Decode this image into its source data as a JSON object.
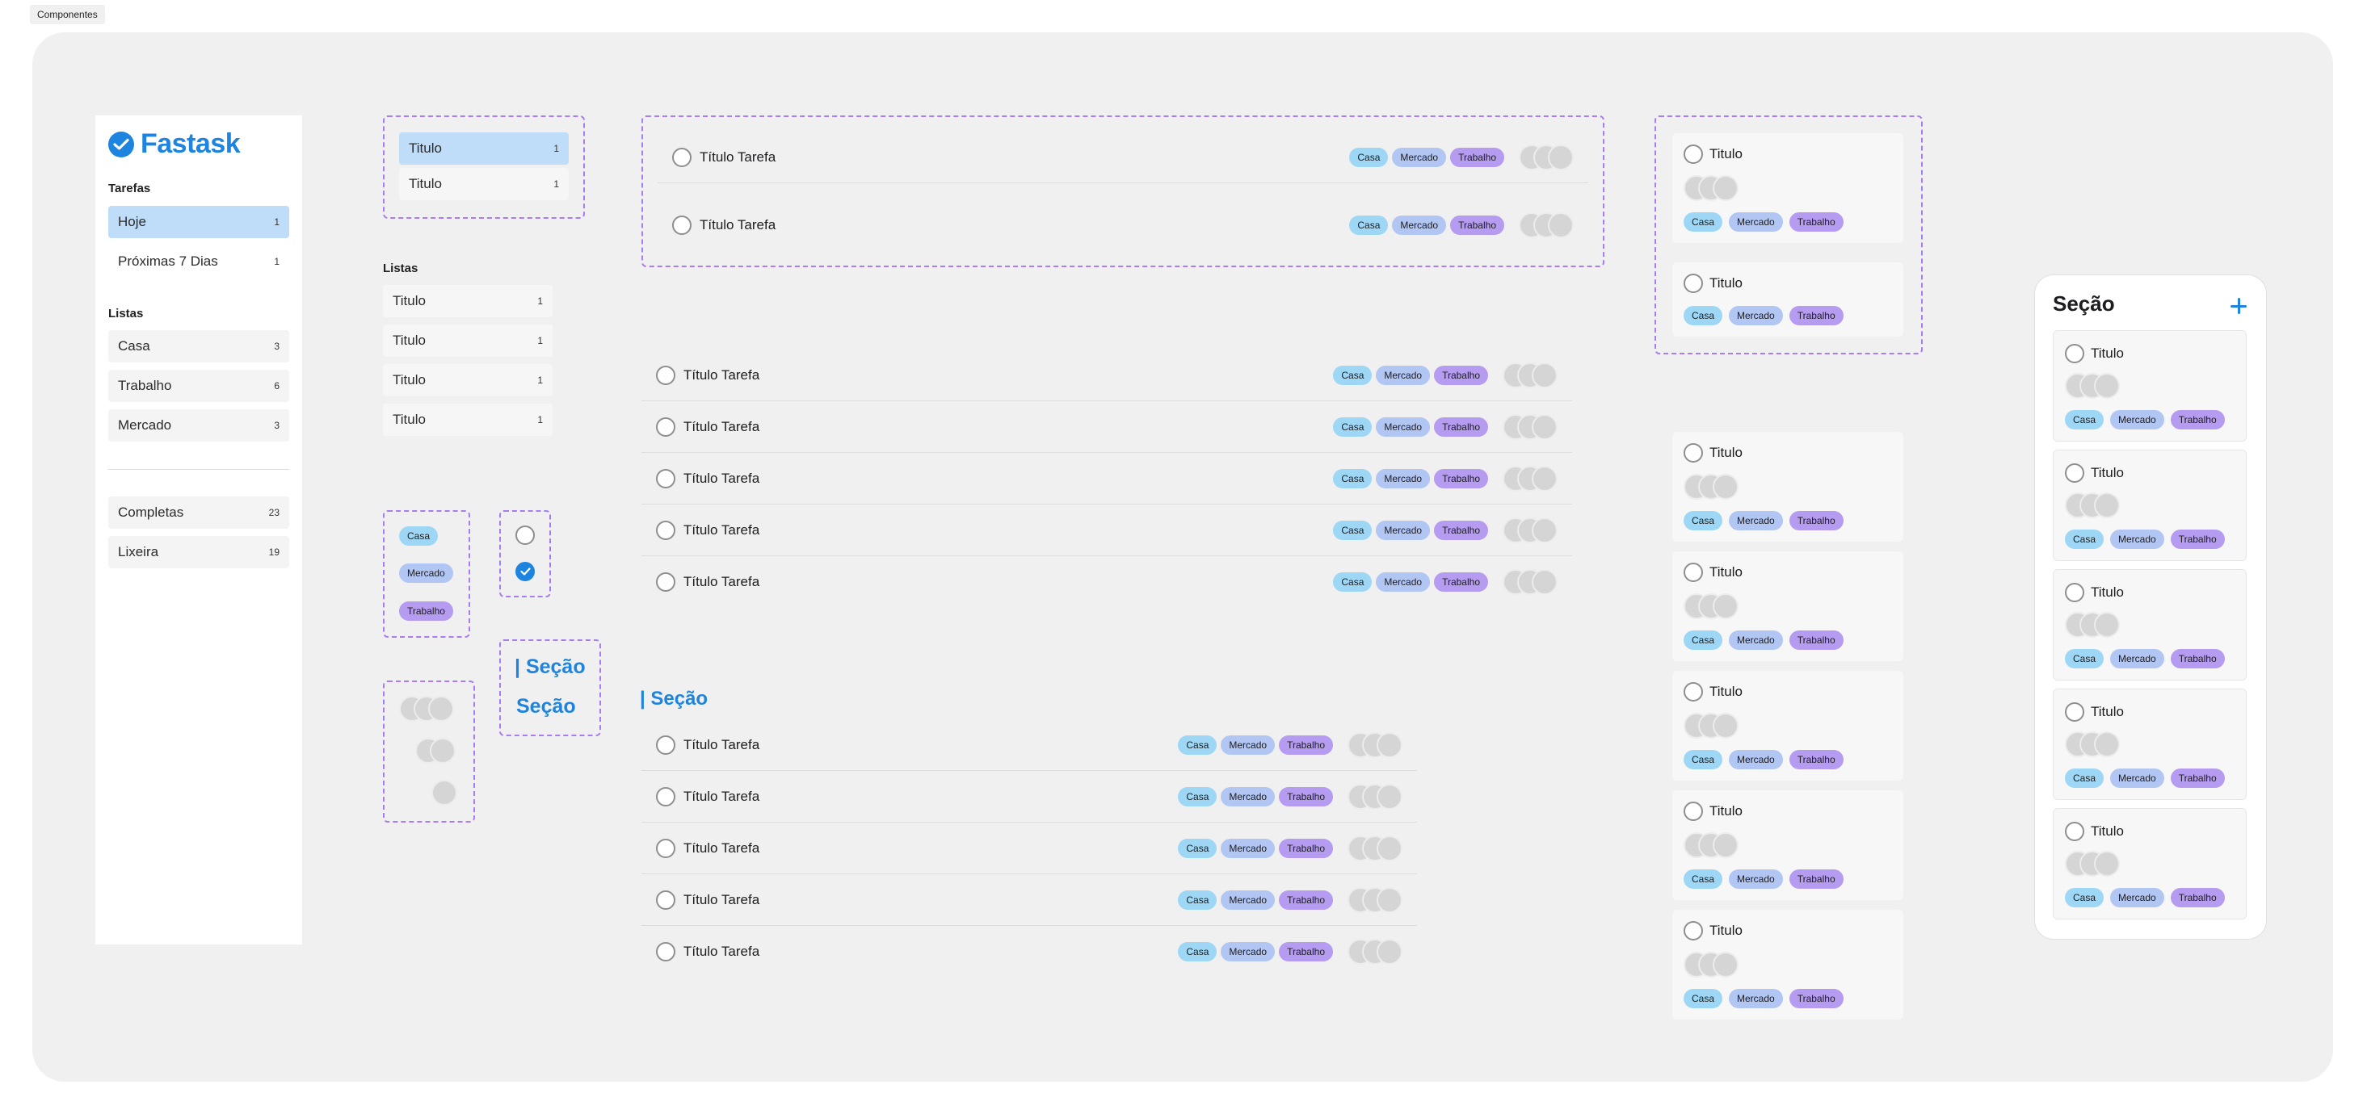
{
  "frame_label": "Componentes",
  "brand": {
    "name": "Fastask",
    "color": "#1d84e0"
  },
  "sidebar": {
    "tasks_heading": "Tarefas",
    "task_items": [
      {
        "label": "Hoje",
        "count": "1",
        "active": true
      },
      {
        "label": "Próximas 7 Dias",
        "count": "1"
      }
    ],
    "lists_heading": "Listas",
    "list_items": [
      {
        "label": "Casa",
        "count": "3"
      },
      {
        "label": "Trabalho",
        "count": "6"
      },
      {
        "label": "Mercado",
        "count": "3"
      }
    ],
    "extra_items": [
      {
        "label": "Completas",
        "count": "23"
      },
      {
        "label": "Lixeira",
        "count": "19"
      }
    ]
  },
  "components": {
    "nav_variants": [
      {
        "label": "Titulo",
        "count": "1"
      },
      {
        "label": "Titulo",
        "count": "1"
      }
    ],
    "lists_heading": "Listas",
    "list_variants": [
      {
        "label": "Titulo",
        "count": "1"
      },
      {
        "label": "Titulo",
        "count": "1"
      },
      {
        "label": "Titulo",
        "count": "1"
      },
      {
        "label": "Titulo",
        "count": "1"
      }
    ],
    "tags": [
      "Casa",
      "Mercado",
      "Trabalho"
    ],
    "section_variant_a": "| Seção",
    "section_variant_b": "Seção"
  },
  "tag_labels": {
    "casa": "Casa",
    "mercado": "Mercado",
    "trabalho": "Trabalho"
  },
  "task_title": "Título Tarefa",
  "section_heading": "| Seção",
  "card_title": "Titulo",
  "section_panel": {
    "title": "Seção"
  },
  "colors": {
    "casa": "#9ed7f6",
    "mercado": "#b2c6f4",
    "trabalho": "#b59cf0",
    "accent": "#1d84e0",
    "dashed": "#a87cf2"
  }
}
